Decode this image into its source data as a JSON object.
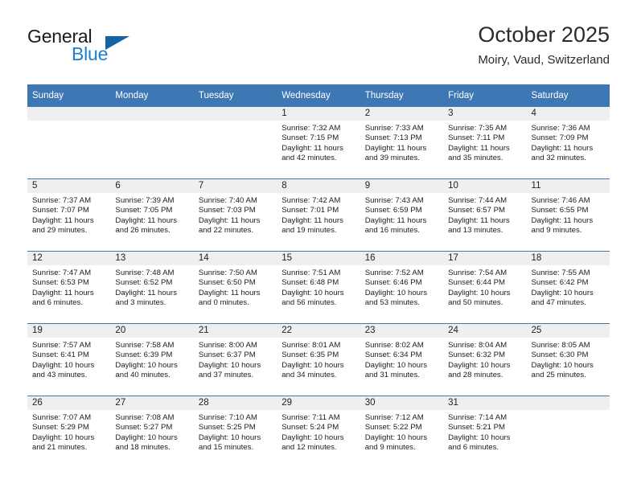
{
  "brand": {
    "name_part1": "General",
    "name_part2": "Blue",
    "triangle_color": "#1464a5",
    "blue_text_color": "#1b7fd4"
  },
  "header": {
    "title": "October 2025",
    "subtitle": "Moiry, Vaud, Switzerland"
  },
  "theme": {
    "header_blue": "#3d78b4",
    "daynum_band": "#efefef",
    "text": "#1c1c1c"
  },
  "weekdays": [
    "Sunday",
    "Monday",
    "Tuesday",
    "Wednesday",
    "Thursday",
    "Friday",
    "Saturday"
  ],
  "weeks": [
    [
      {
        "day": "",
        "empty": true
      },
      {
        "day": "",
        "empty": true
      },
      {
        "day": "",
        "empty": true
      },
      {
        "day": "1",
        "sunrise": "Sunrise: 7:32 AM",
        "sunset": "Sunset: 7:15 PM",
        "daylight_line1": "Daylight: 11 hours",
        "daylight_line2": "and 42 minutes."
      },
      {
        "day": "2",
        "sunrise": "Sunrise: 7:33 AM",
        "sunset": "Sunset: 7:13 PM",
        "daylight_line1": "Daylight: 11 hours",
        "daylight_line2": "and 39 minutes."
      },
      {
        "day": "3",
        "sunrise": "Sunrise: 7:35 AM",
        "sunset": "Sunset: 7:11 PM",
        "daylight_line1": "Daylight: 11 hours",
        "daylight_line2": "and 35 minutes."
      },
      {
        "day": "4",
        "sunrise": "Sunrise: 7:36 AM",
        "sunset": "Sunset: 7:09 PM",
        "daylight_line1": "Daylight: 11 hours",
        "daylight_line2": "and 32 minutes."
      }
    ],
    [
      {
        "day": "5",
        "sunrise": "Sunrise: 7:37 AM",
        "sunset": "Sunset: 7:07 PM",
        "daylight_line1": "Daylight: 11 hours",
        "daylight_line2": "and 29 minutes."
      },
      {
        "day": "6",
        "sunrise": "Sunrise: 7:39 AM",
        "sunset": "Sunset: 7:05 PM",
        "daylight_line1": "Daylight: 11 hours",
        "daylight_line2": "and 26 minutes."
      },
      {
        "day": "7",
        "sunrise": "Sunrise: 7:40 AM",
        "sunset": "Sunset: 7:03 PM",
        "daylight_line1": "Daylight: 11 hours",
        "daylight_line2": "and 22 minutes."
      },
      {
        "day": "8",
        "sunrise": "Sunrise: 7:42 AM",
        "sunset": "Sunset: 7:01 PM",
        "daylight_line1": "Daylight: 11 hours",
        "daylight_line2": "and 19 minutes."
      },
      {
        "day": "9",
        "sunrise": "Sunrise: 7:43 AM",
        "sunset": "Sunset: 6:59 PM",
        "daylight_line1": "Daylight: 11 hours",
        "daylight_line2": "and 16 minutes."
      },
      {
        "day": "10",
        "sunrise": "Sunrise: 7:44 AM",
        "sunset": "Sunset: 6:57 PM",
        "daylight_line1": "Daylight: 11 hours",
        "daylight_line2": "and 13 minutes."
      },
      {
        "day": "11",
        "sunrise": "Sunrise: 7:46 AM",
        "sunset": "Sunset: 6:55 PM",
        "daylight_line1": "Daylight: 11 hours",
        "daylight_line2": "and 9 minutes."
      }
    ],
    [
      {
        "day": "12",
        "sunrise": "Sunrise: 7:47 AM",
        "sunset": "Sunset: 6:53 PM",
        "daylight_line1": "Daylight: 11 hours",
        "daylight_line2": "and 6 minutes."
      },
      {
        "day": "13",
        "sunrise": "Sunrise: 7:48 AM",
        "sunset": "Sunset: 6:52 PM",
        "daylight_line1": "Daylight: 11 hours",
        "daylight_line2": "and 3 minutes."
      },
      {
        "day": "14",
        "sunrise": "Sunrise: 7:50 AM",
        "sunset": "Sunset: 6:50 PM",
        "daylight_line1": "Daylight: 11 hours",
        "daylight_line2": "and 0 minutes."
      },
      {
        "day": "15",
        "sunrise": "Sunrise: 7:51 AM",
        "sunset": "Sunset: 6:48 PM",
        "daylight_line1": "Daylight: 10 hours",
        "daylight_line2": "and 56 minutes."
      },
      {
        "day": "16",
        "sunrise": "Sunrise: 7:52 AM",
        "sunset": "Sunset: 6:46 PM",
        "daylight_line1": "Daylight: 10 hours",
        "daylight_line2": "and 53 minutes."
      },
      {
        "day": "17",
        "sunrise": "Sunrise: 7:54 AM",
        "sunset": "Sunset: 6:44 PM",
        "daylight_line1": "Daylight: 10 hours",
        "daylight_line2": "and 50 minutes."
      },
      {
        "day": "18",
        "sunrise": "Sunrise: 7:55 AM",
        "sunset": "Sunset: 6:42 PM",
        "daylight_line1": "Daylight: 10 hours",
        "daylight_line2": "and 47 minutes."
      }
    ],
    [
      {
        "day": "19",
        "sunrise": "Sunrise: 7:57 AM",
        "sunset": "Sunset: 6:41 PM",
        "daylight_line1": "Daylight: 10 hours",
        "daylight_line2": "and 43 minutes."
      },
      {
        "day": "20",
        "sunrise": "Sunrise: 7:58 AM",
        "sunset": "Sunset: 6:39 PM",
        "daylight_line1": "Daylight: 10 hours",
        "daylight_line2": "and 40 minutes."
      },
      {
        "day": "21",
        "sunrise": "Sunrise: 8:00 AM",
        "sunset": "Sunset: 6:37 PM",
        "daylight_line1": "Daylight: 10 hours",
        "daylight_line2": "and 37 minutes."
      },
      {
        "day": "22",
        "sunrise": "Sunrise: 8:01 AM",
        "sunset": "Sunset: 6:35 PM",
        "daylight_line1": "Daylight: 10 hours",
        "daylight_line2": "and 34 minutes."
      },
      {
        "day": "23",
        "sunrise": "Sunrise: 8:02 AM",
        "sunset": "Sunset: 6:34 PM",
        "daylight_line1": "Daylight: 10 hours",
        "daylight_line2": "and 31 minutes."
      },
      {
        "day": "24",
        "sunrise": "Sunrise: 8:04 AM",
        "sunset": "Sunset: 6:32 PM",
        "daylight_line1": "Daylight: 10 hours",
        "daylight_line2": "and 28 minutes."
      },
      {
        "day": "25",
        "sunrise": "Sunrise: 8:05 AM",
        "sunset": "Sunset: 6:30 PM",
        "daylight_line1": "Daylight: 10 hours",
        "daylight_line2": "and 25 minutes."
      }
    ],
    [
      {
        "day": "26",
        "sunrise": "Sunrise: 7:07 AM",
        "sunset": "Sunset: 5:29 PM",
        "daylight_line1": "Daylight: 10 hours",
        "daylight_line2": "and 21 minutes."
      },
      {
        "day": "27",
        "sunrise": "Sunrise: 7:08 AM",
        "sunset": "Sunset: 5:27 PM",
        "daylight_line1": "Daylight: 10 hours",
        "daylight_line2": "and 18 minutes."
      },
      {
        "day": "28",
        "sunrise": "Sunrise: 7:10 AM",
        "sunset": "Sunset: 5:25 PM",
        "daylight_line1": "Daylight: 10 hours",
        "daylight_line2": "and 15 minutes."
      },
      {
        "day": "29",
        "sunrise": "Sunrise: 7:11 AM",
        "sunset": "Sunset: 5:24 PM",
        "daylight_line1": "Daylight: 10 hours",
        "daylight_line2": "and 12 minutes."
      },
      {
        "day": "30",
        "sunrise": "Sunrise: 7:12 AM",
        "sunset": "Sunset: 5:22 PM",
        "daylight_line1": "Daylight: 10 hours",
        "daylight_line2": "and 9 minutes."
      },
      {
        "day": "31",
        "sunrise": "Sunrise: 7:14 AM",
        "sunset": "Sunset: 5:21 PM",
        "daylight_line1": "Daylight: 10 hours",
        "daylight_line2": "and 6 minutes."
      },
      {
        "day": "",
        "empty": true
      }
    ]
  ]
}
